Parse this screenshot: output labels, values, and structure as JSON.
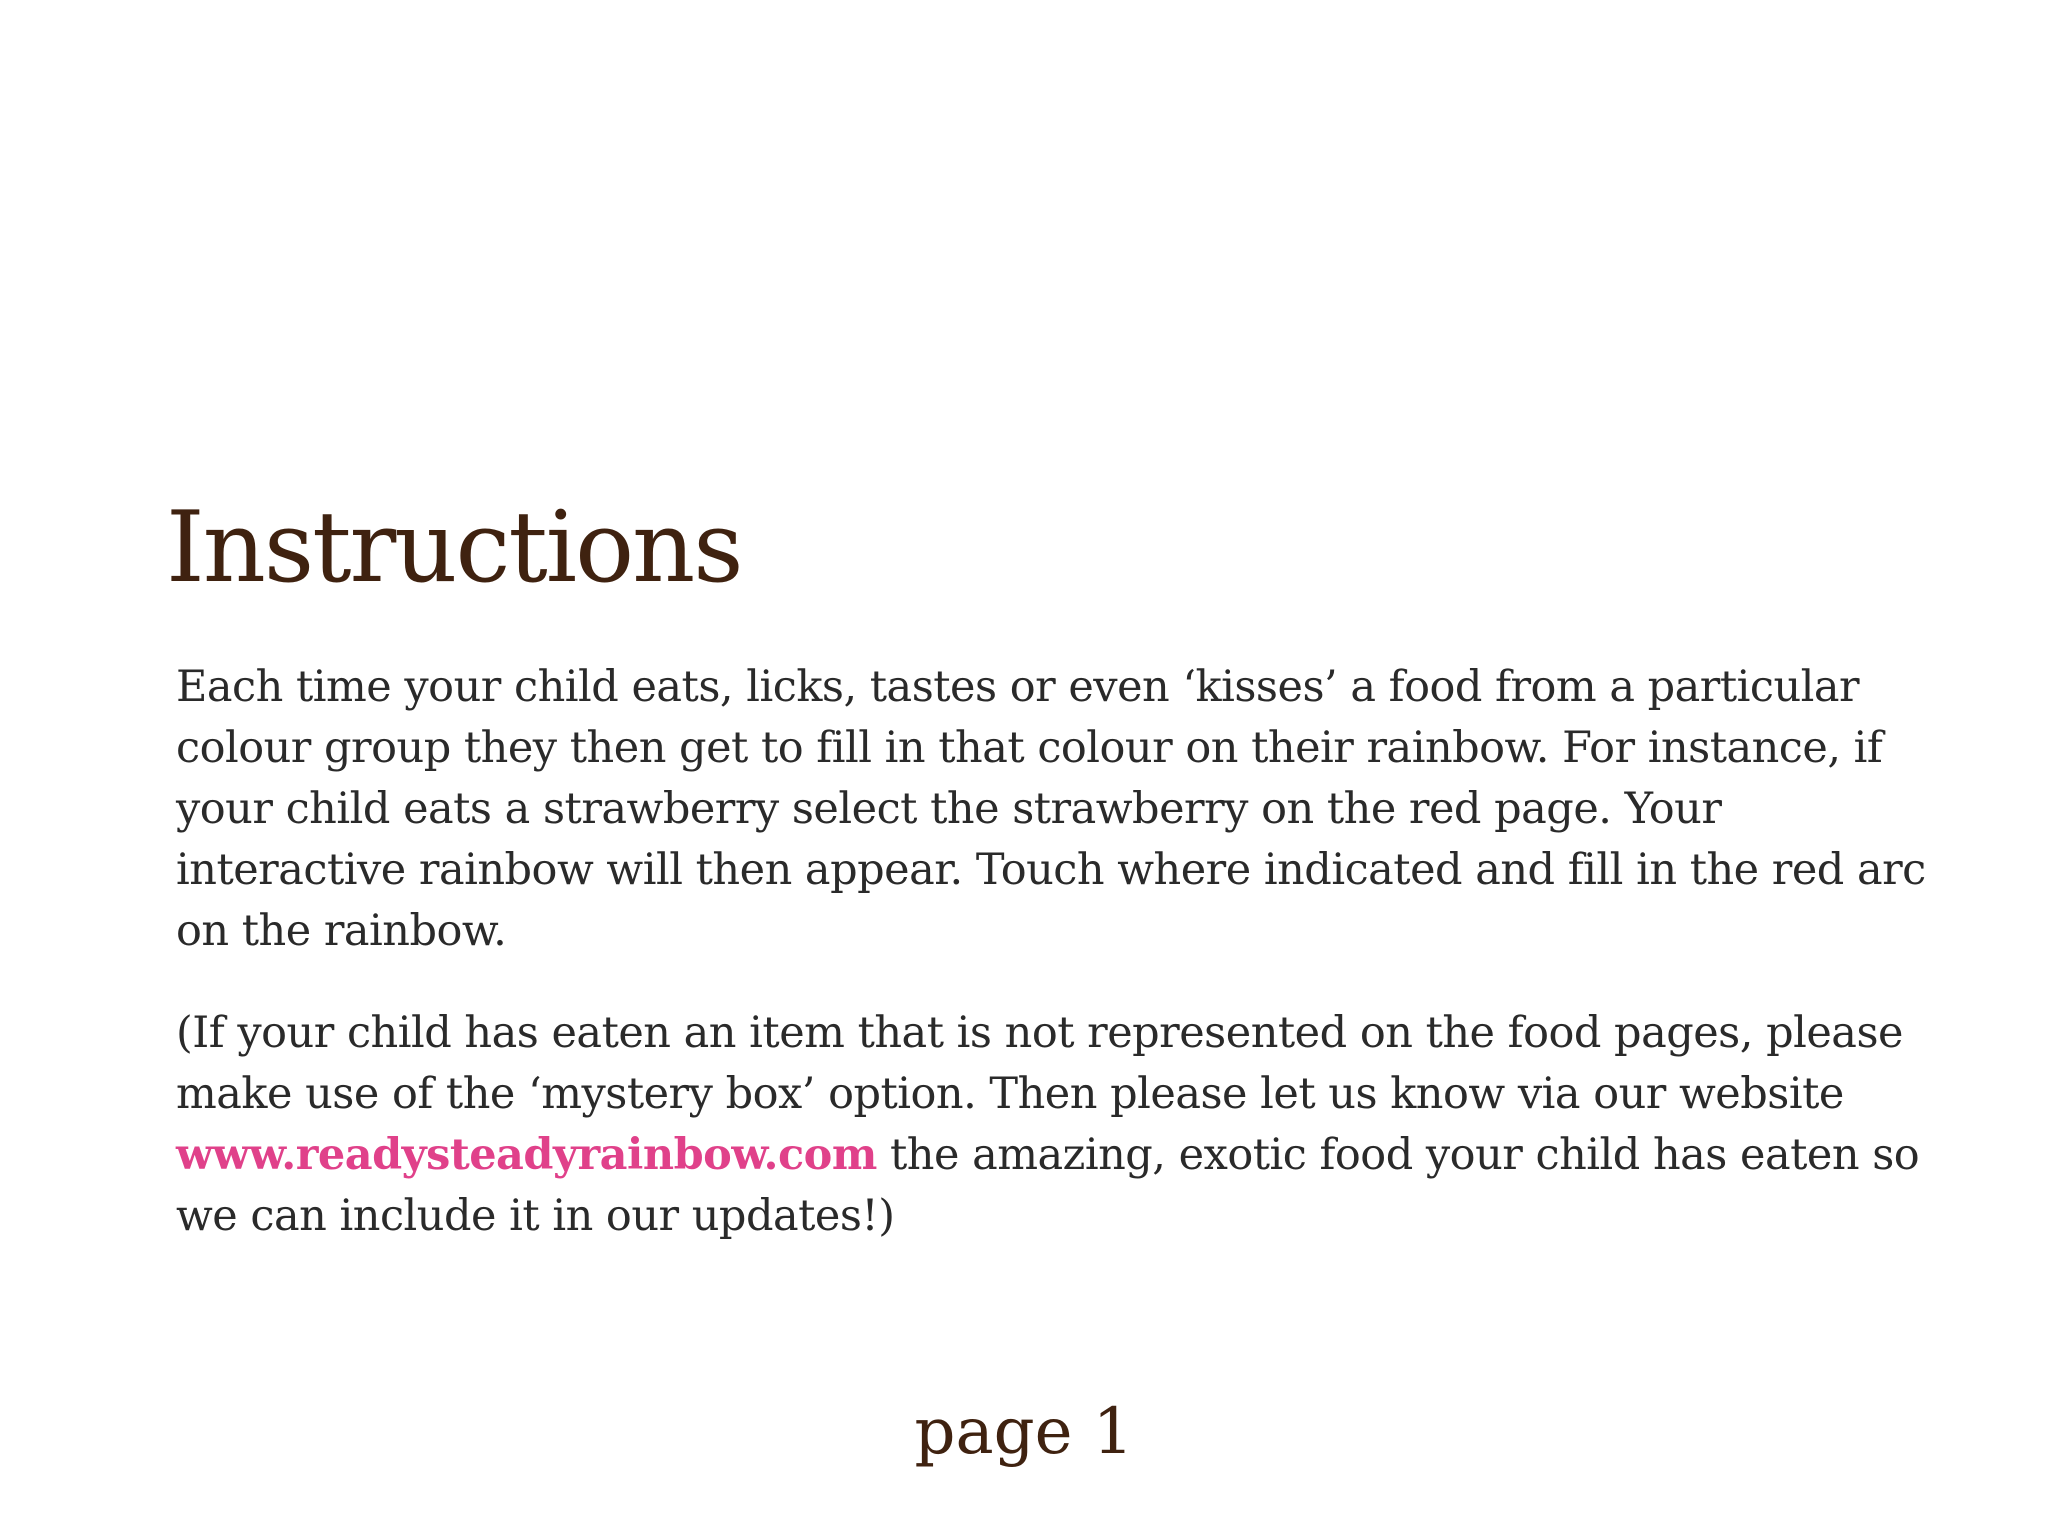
{
  "title": "Instructions",
  "paragraph_1": "Each time your child eats, licks, tastes or even ‘kisses’ a food from a particular colour group they then get to fill in that colour on their rainbow. For instance, if your child eats a strawberry select the strawberry on the red page. Your interactive rainbow will then appear. Touch where indicated and fill in the red arc on the rainbow.",
  "paragraph_2": {
    "before_link": "(If your child has eaten an item that is not represented on the food pages, please make use of the ‘mystery box’ option. Then please let us know via our website ",
    "link_text": "www.readysteadyrainbow.com",
    "after_link": " the amazing, exotic food your child has eaten so we can include it in our updates!)"
  },
  "page_label": "page 1",
  "colors": {
    "heading": "#3f2210",
    "body": "#2a2a2a",
    "link": "#e0418a",
    "background": "#ffffff"
  }
}
